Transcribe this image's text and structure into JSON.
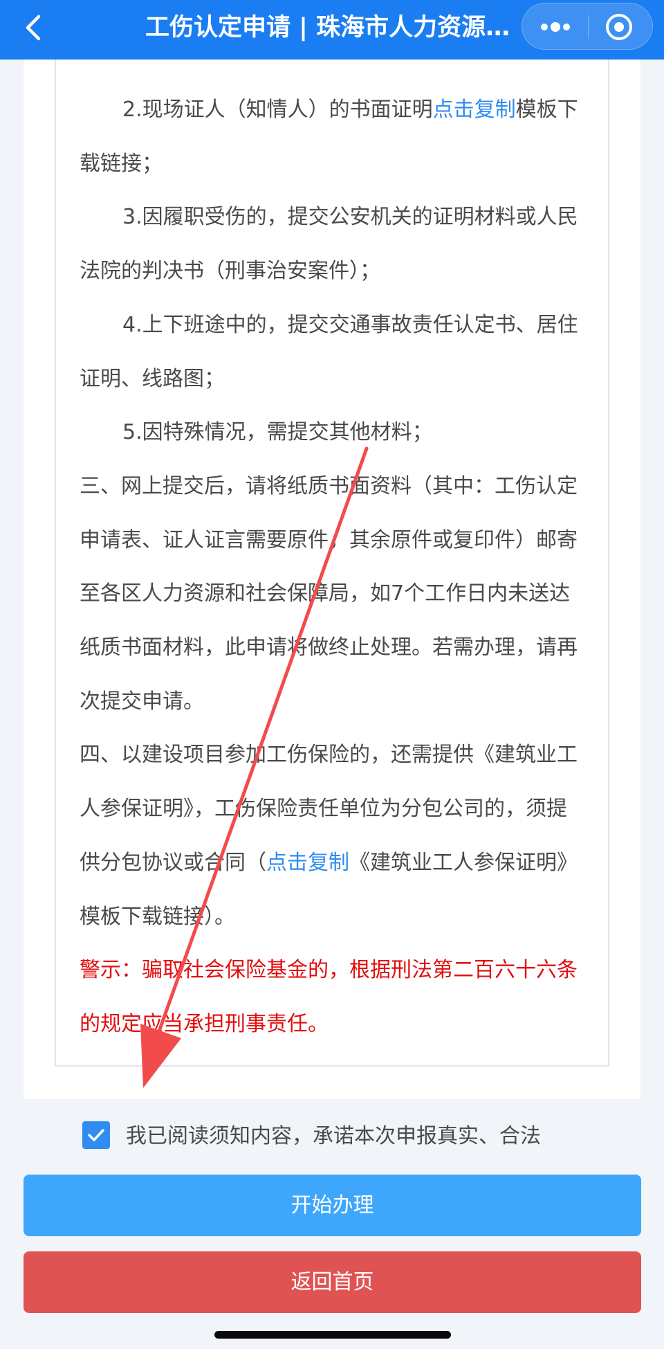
{
  "header": {
    "title": "工伤认定申请 | 珠海市人力资源和社会保障局",
    "background_color": "#1a7df1",
    "back_icon": "chevron-left-icon",
    "more_icon": "more-dots-icon",
    "close_icon": "target-circle-icon"
  },
  "notice": {
    "item2": {
      "prefix": "2.现场证人（知情人）的书面证明",
      "link": "点击复制",
      "suffix": "模板下载链接；"
    },
    "item3": "3.因履职受伤的，提交公安机关的证明材料或人民法院的判决书（刑事治安案件）；",
    "item4": "4.上下班途中的，提交交通事故责任认定书、居住证明、线路图；",
    "item5": "5.因特殊情况，需提交其他材料；",
    "section3": "三、网上提交后，请将纸质书面资料（其中：工伤认定申请表、证人证言需要原件，其余原件或复印件）邮寄至各区人力资源和社会保障局，如7个工作日内未送达纸质书面材料，此申请将做终止处理。若需办理，请再次提交申请。",
    "section4": {
      "prefix": "四、以建设项目参加工伤保险的，还需提供《建筑业工人参保证明》，工伤保险责任单位为分包公司的，须提供分包协议或合同（",
      "link": "点击复制",
      "suffix": "《建筑业工人参保证明》模板下载链接）。"
    },
    "warning": "警示：骗取社会保险基金的，根据刑法第二百六十六条的规定应当承担刑事责任。",
    "link_color": "#2f8cf0",
    "warning_color": "#e30d0d"
  },
  "agreement": {
    "checked": true,
    "text": "我已阅读须知内容，承诺本次申报真实、合法",
    "checkbox_color": "#2f8cf0"
  },
  "buttons": {
    "start": "开始办理",
    "start_color": "#3fa7fb",
    "home": "返回首页",
    "home_color": "#e05353"
  },
  "annotation": {
    "arrow_color": "#f24b4b"
  }
}
